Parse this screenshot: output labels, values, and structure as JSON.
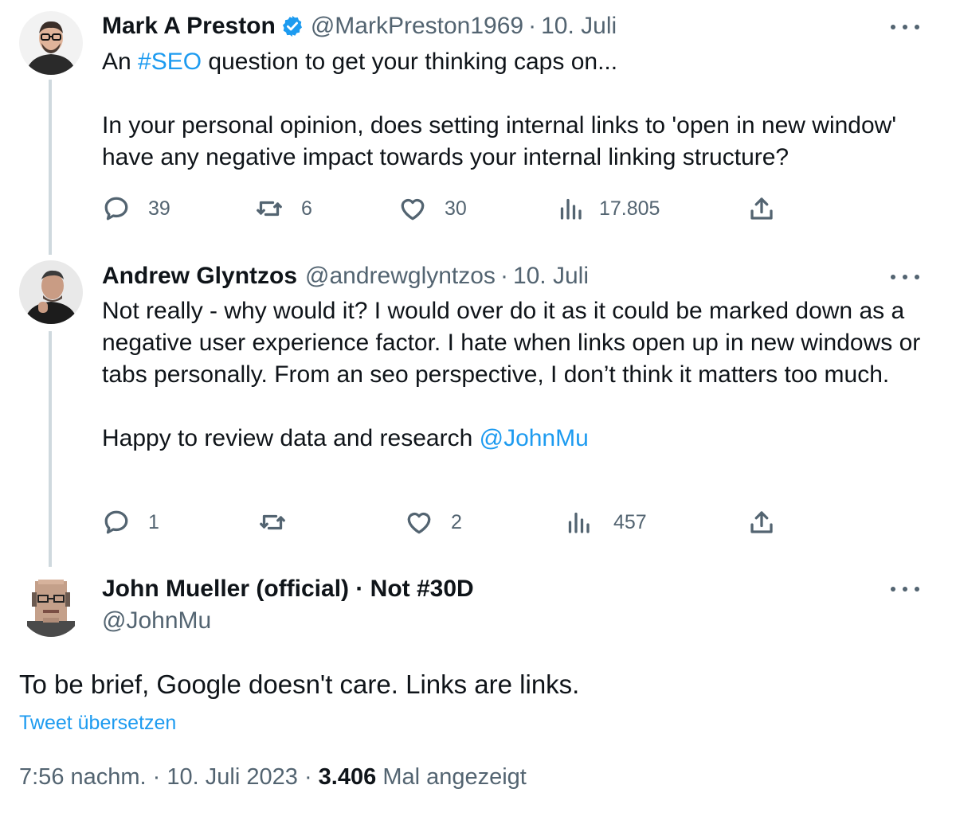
{
  "tweets": [
    {
      "name": "Mark A Preston",
      "verified": true,
      "handle": "@MarkPreston1969",
      "separator": "·",
      "date": "10. Juli",
      "text_prefix": "An ",
      "hashtag": "#SEO",
      "text_rest": " question to get your thinking caps on...",
      "paragraph2": "In your personal opinion, does setting internal links to 'open in new window' have any negative impact towards your internal linking structure?",
      "stats": {
        "replies": "39",
        "retweets": "6",
        "likes": "30",
        "views": "17.805"
      }
    },
    {
      "name": "Andrew Glyntzos",
      "handle": "@andrewglyntzos",
      "separator": "·",
      "date": "10. Juli",
      "paragraph1": "Not really - why would it? I would over do it as it could be marked down as a negative user experience factor. I hate when links open up in new windows or tabs personally. From an seo perspective, I don’t think it matters too much.",
      "paragraph2_prefix": "Happy to review data and research ",
      "mention": "@JohnMu",
      "stats": {
        "replies": "1",
        "retweets": "",
        "likes": "2",
        "views": "457"
      }
    }
  ],
  "main": {
    "name": "John Mueller (official) · Not #30D",
    "handle": "@JohnMu",
    "text": "To be brief, Google doesn't care. Links are links.",
    "translate_label": "Tweet übersetzen",
    "time": "7:56 nachm.",
    "separator": "·",
    "date": "10. Juli 2023",
    "views_count": "3.406",
    "views_label": "Mal angezeigt"
  },
  "colors": {
    "link": "#1d9bf0",
    "text": "#0f1419",
    "secondary": "#536471",
    "thread_line": "#cfd9de",
    "verified": "#1d9bf0"
  },
  "icons": [
    "verified-badge-icon",
    "more-icon",
    "reply-icon",
    "retweet-icon",
    "like-icon",
    "views-icon",
    "share-icon"
  ]
}
